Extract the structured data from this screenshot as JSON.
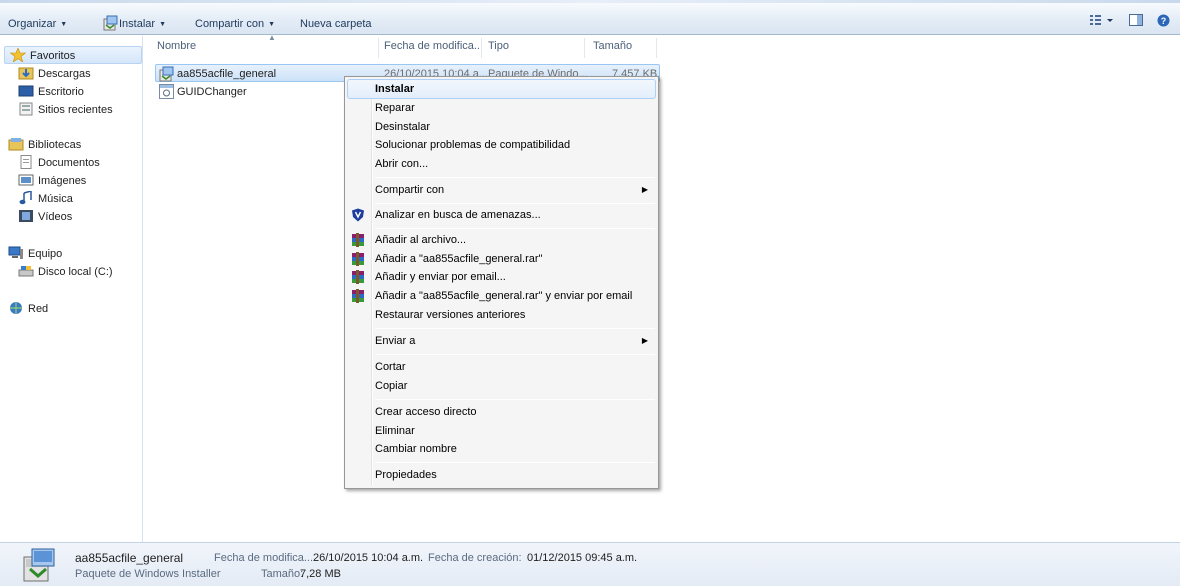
{
  "toolbar": {
    "organize": "Organizar",
    "install": "Instalar",
    "share": "Compartir con",
    "new_folder": "Nueva carpeta"
  },
  "nav": {
    "favorites": "Favoritos",
    "downloads": "Descargas",
    "desktop": "Escritorio",
    "recent": "Sitios recientes",
    "libraries": "Bibliotecas",
    "documents": "Documentos",
    "images": "Imágenes",
    "music": "Música",
    "videos": "Vídeos",
    "computer": "Equipo",
    "local_disk": "Disco local (C:)",
    "network": "Red"
  },
  "columns": {
    "name": "Nombre",
    "date": "Fecha de modifica...",
    "type": "Tipo",
    "size": "Tamaño"
  },
  "files": [
    {
      "name": "aa855acfile_general",
      "date": "26/10/2015 10:04 a...",
      "type": "Paquete de Windo...",
      "size": "7.457 KB"
    },
    {
      "name": "GUIDChanger",
      "date": "",
      "type": "",
      "size": ""
    }
  ],
  "menu": {
    "install": "Instalar",
    "repair": "Reparar",
    "uninstall": "Desinstalar",
    "compat": "Solucionar problemas de compatibilidad",
    "open_with": "Abrir con...",
    "share": "Compartir con",
    "scan": "Analizar en busca de amenazas...",
    "add_archive": "Añadir al archivo...",
    "add_rar": "Añadir a \"aa855acfile_general.rar\"",
    "add_email": "Añadir y enviar por email...",
    "add_rar_email": "Añadir a \"aa855acfile_general.rar\" y enviar por email",
    "restore": "Restaurar versiones anteriores",
    "send_to": "Enviar a",
    "cut": "Cortar",
    "copy": "Copiar",
    "shortcut": "Crear acceso directo",
    "delete": "Eliminar",
    "rename": "Cambiar nombre",
    "properties": "Propiedades"
  },
  "details": {
    "name": "aa855acfile_general",
    "type": "Paquete de Windows Installer",
    "date_label": "Fecha de modifica...",
    "date_value": "26/10/2015 10:04 a.m.",
    "created_label": "Fecha de creación:",
    "created_value": "01/12/2015 09:45 a.m.",
    "size_label": "Tamaño:",
    "size_value": "7,28 MB"
  },
  "colors": {
    "toolbar_text": "#1e395b",
    "selection": "#cce2f8",
    "menu_bg": "#f5f5f5"
  }
}
